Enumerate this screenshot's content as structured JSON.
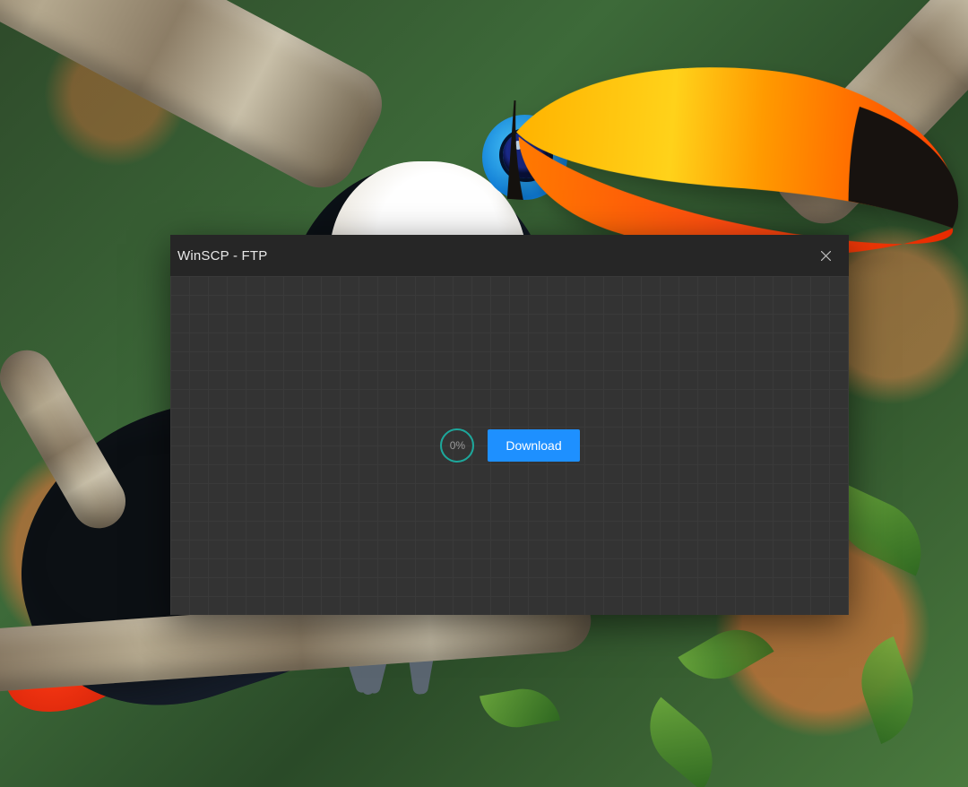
{
  "dialog": {
    "title": "WinSCP - FTP",
    "close_tooltip": "Close",
    "progress": {
      "percent_value": 0,
      "percent_label": "0%",
      "ring_color": "#17b1a4",
      "track_color": "#4a4a4a"
    },
    "download_button_label": "Download",
    "accent_color": "#1e90ff"
  }
}
